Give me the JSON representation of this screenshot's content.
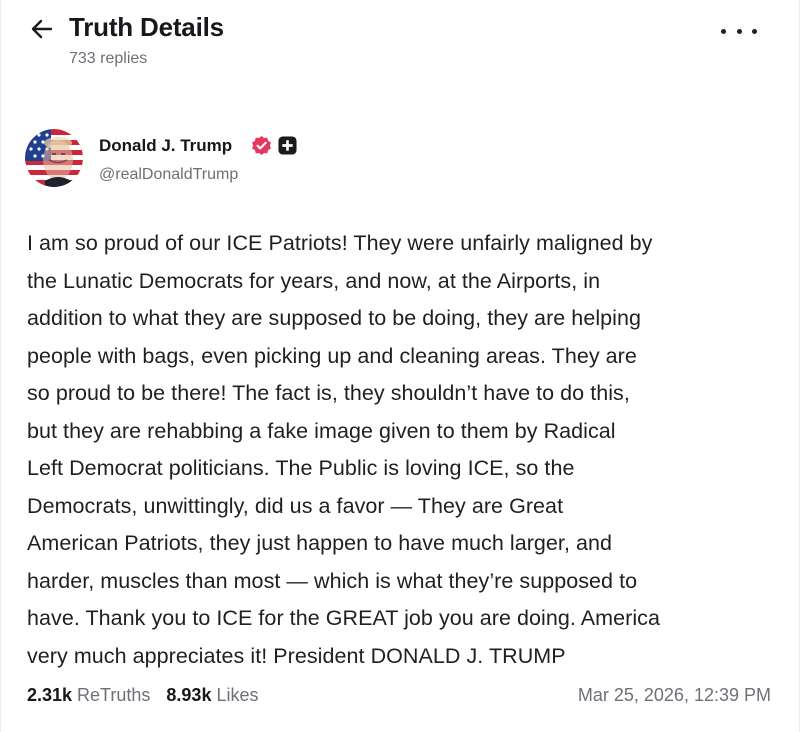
{
  "header": {
    "title": "Truth Details",
    "subtitle": "733 replies"
  },
  "author": {
    "name": "Donald J. Trump",
    "handle": "@realDonaldTrump"
  },
  "post": {
    "text": "I am so proud of our ICE Patriots! They were unfairly maligned by\nthe Lunatic Democrats for years, and now, at the Airports, in\naddition to what they are supposed to be doing, they are helping\npeople with bags, even picking up and cleaning areas. They are\nso proud to be there! The fact is, they shouldn’t have to do this,\nbut they are rehabbing a fake image given to them by Radical\nLeft Democrat politicians. The Public is loving ICE, so the\nDemocrats, unwittingly, did us a favor — They are Great\nAmerican Patriots, they just happen to have much larger, and\nharder, muscles than most — which is what they’re supposed to\nhave. Thank you to ICE for the GREAT job you are doing. America\nvery much appreciates it! President DONALD J. TRUMP"
  },
  "stats": {
    "retruths_count": "2.31k",
    "retruths_label": "ReTruths",
    "likes_count": "8.93k",
    "likes_label": "Likes",
    "timestamp": "Mar 25, 2026, 12:39 PM"
  },
  "icons": {
    "back": "arrow-left-icon",
    "more": "more-horizontal-icon",
    "verified": "verified-badge-icon",
    "plus_badge": "plus-badge-icon"
  },
  "colors": {
    "verified": "#e5385f",
    "muted_text": "#6f6f78",
    "primary_text": "#17171c"
  }
}
